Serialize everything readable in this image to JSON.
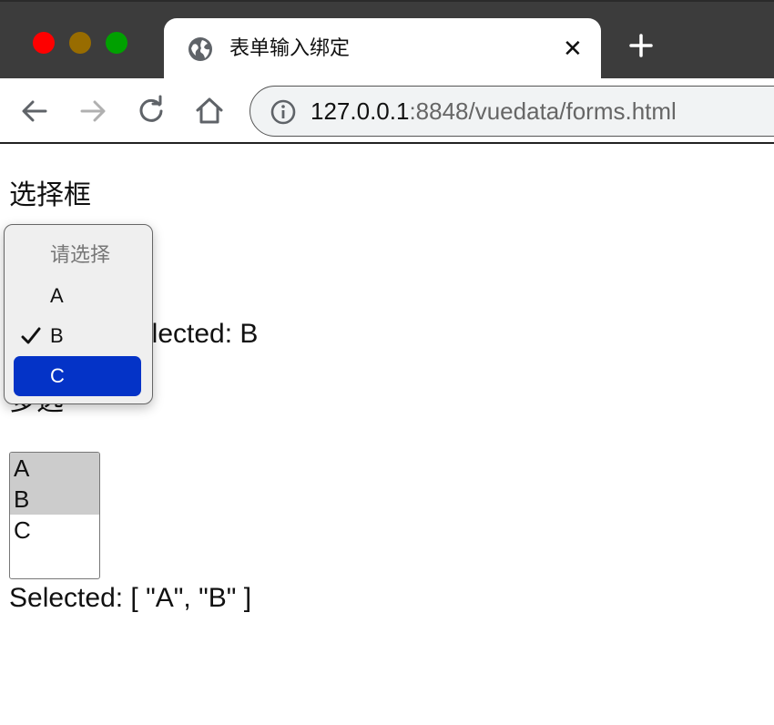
{
  "browser": {
    "tab": {
      "title": "表单输入绑定",
      "close_label": "✕"
    },
    "omnibox": {
      "url_host": "127.0.0.1",
      "url_rest": ":8848/vuedata/forms.html"
    }
  },
  "page": {
    "select_heading": "选择框",
    "select_result": "elected: B",
    "dropdown": {
      "placeholder": "请选择",
      "options": [
        "A",
        "B",
        "C"
      ],
      "selected_value": "B",
      "highlighted_value": "C"
    },
    "multi_heading": "多选",
    "listbox": {
      "options": [
        "A",
        "B",
        "C"
      ],
      "selected": [
        "A",
        "B"
      ]
    },
    "multi_result": "Selected: [ \"A\", \"B\" ]"
  },
  "colors": {
    "highlight": "#0433c7",
    "listbox_selected": "#cccccc",
    "traffic_red": "#fe0000",
    "traffic_yellow": "#986c00",
    "traffic_green": "#00a000"
  },
  "icons": [
    "globe-icon",
    "close-icon",
    "plus-icon",
    "back-arrow-icon",
    "forward-arrow-icon",
    "reload-icon",
    "home-icon",
    "info-icon",
    "checkmark-icon"
  ]
}
